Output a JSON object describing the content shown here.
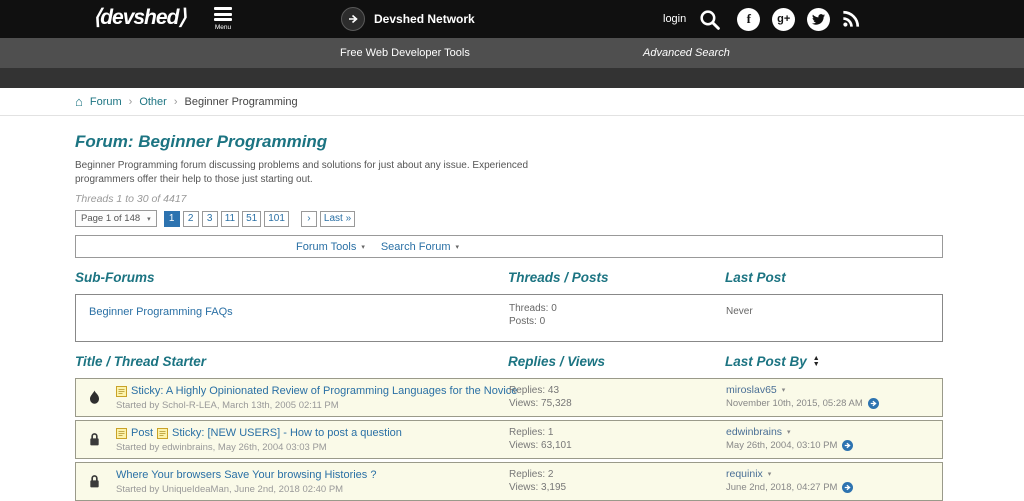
{
  "colors": {
    "header_bg": "#101010",
    "subnav_bg": "#4f4f4f",
    "accent_teal": "#1c7482",
    "link_blue": "#2a70a5",
    "active_page_bg": "#2d73b0",
    "thread_row_bg": "#fafae8"
  },
  "icons": {
    "home": "⌂",
    "chevron_down": "▾",
    "sort_up": "▲",
    "sort_down": "▼",
    "breadcrumb_sep": "›"
  },
  "header": {
    "logo": "⟨devshed⟩",
    "menu_label": "Menu",
    "network_label": "Devshed Network",
    "login_label": "login",
    "facebook_glyph": "f",
    "gplus_glyph": "g+"
  },
  "subnav": {
    "tools_label": "Free Web Developer Tools",
    "advanced_search_label": "Advanced Search"
  },
  "breadcrumb": {
    "items": [
      {
        "label": "Forum"
      },
      {
        "label": "Other"
      },
      {
        "label": "Beginner Programming"
      }
    ]
  },
  "forum": {
    "title": "Forum: Beginner Programming",
    "description": "Beginner Programming forum discussing problems and solutions for just about any issue. Experienced programmers offer their help to those just starting out.",
    "range_label": "Threads 1 to 30 of 4417"
  },
  "pagination": {
    "page_select_label": "Page 1 of 148",
    "pages": [
      "1",
      "2",
      "3",
      "11",
      "51",
      "101"
    ],
    "active_page": "1",
    "next_label": "›",
    "last_label": "Last »"
  },
  "toolbar": {
    "forum_tools_label": "Forum Tools",
    "search_forum_label": "Search Forum"
  },
  "subforums": {
    "heading": "Sub-Forums",
    "threads_posts_header": "Threads / Posts",
    "last_post_header": "Last Post",
    "rows": [
      {
        "name": "Beginner Programming FAQs",
        "threads": "Threads: 0",
        "posts": "Posts: 0",
        "last_post": "Never"
      }
    ]
  },
  "threadlist": {
    "heading": "Title / Thread Starter",
    "replies_views_header": "Replies / Views",
    "last_post_by_header": "Last Post By",
    "rows": [
      {
        "icon": "hot-thread-icon",
        "title": "Sticky: A Highly Opinionated Review of Programming Languages for the Novice",
        "started_by": "Started by Schol-R-LEA, March 13th, 2005 02:11 PM",
        "replies": "Replies: 43",
        "views": "Views: 75,328",
        "last_post_by": "miroslav65",
        "last_post_date": "November 10th, 2015, 05:28 AM"
      },
      {
        "icon": "lock-icon",
        "badge": "Post",
        "title": "Sticky: [NEW USERS] - How to post a question",
        "started_by": "Started by edwinbrains, May 26th, 2004 03:03 PM",
        "replies": "Replies: 1",
        "views": "Views: 63,101",
        "last_post_by": "edwinbrains",
        "last_post_date": "May 26th, 2004, 03:10 PM"
      },
      {
        "icon": "lock-icon",
        "title": "Where Your browsers Save Your browsing Histories ?",
        "started_by": "Started by UniqueIdeaMan, June 2nd, 2018 02:40 PM",
        "replies": "Replies: 2",
        "views": "Views: 3,195",
        "last_post_by": "requinix",
        "last_post_date": "June 2nd, 2018, 04:27 PM"
      }
    ]
  }
}
